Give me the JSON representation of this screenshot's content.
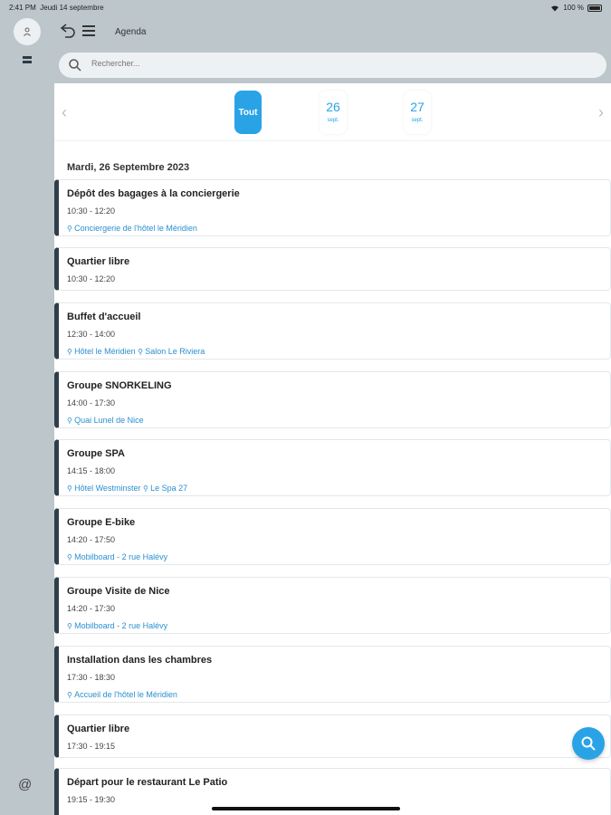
{
  "status_bar": {
    "time": "2:41 PM",
    "date": "Jeudi 14 septembre",
    "battery": "100 %"
  },
  "toolbar": {
    "title": "Agenda"
  },
  "search": {
    "placeholder": "Rechercher..."
  },
  "date_strip": {
    "all_label": "Tout",
    "days": [
      {
        "day": "26",
        "month": "sept."
      },
      {
        "day": "27",
        "month": "sept."
      }
    ]
  },
  "section_title": "Mardi, 26 Septembre 2023",
  "events": [
    {
      "title": "Dépôt des bagages à la conciergerie",
      "time": "10:30 - 12:20",
      "locations": [
        "Conciergerie de l'hôtel le Méridien"
      ]
    },
    {
      "title": "Quartier libre",
      "time": "10:30 - 12:20",
      "locations": []
    },
    {
      "title": "Buffet d'accueil",
      "time": "12:30 - 14:00",
      "locations": [
        "Hôtel le Méridien",
        "Salon Le Riviera"
      ]
    },
    {
      "title": "Groupe SNORKELING",
      "time": "14:00 - 17:30",
      "locations": [
        "Quai Lunel de Nice"
      ]
    },
    {
      "title": "Groupe SPA",
      "time": "14:15 - 18:00",
      "locations": [
        "Hôtel Westminster",
        "Le Spa 27"
      ]
    },
    {
      "title": "Groupe E-bike",
      "time": "14:20 - 17:50",
      "locations": [
        "Mobilboard - 2 rue Halévy"
      ]
    },
    {
      "title": "Groupe Visite de Nice",
      "time": "14:20 - 17:30",
      "locations": [
        "Mobilboard - 2 rue Halévy"
      ]
    },
    {
      "title": "Installation dans les chambres",
      "time": "17:30 - 18:30",
      "locations": [
        "Accueil de l'hôtel le Méridien"
      ]
    },
    {
      "title": "Quartier libre",
      "time": "17:30 - 19:15",
      "locations": []
    },
    {
      "title": "Départ pour le restaurant Le Patio",
      "time": "19:15 - 19:30",
      "locations": []
    }
  ]
}
